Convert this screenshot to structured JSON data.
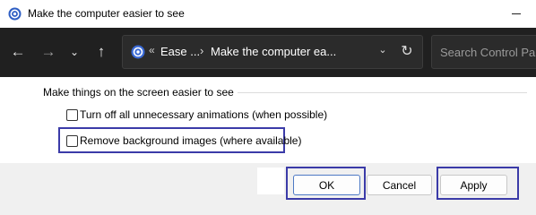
{
  "window": {
    "title": "Make the computer easier to see",
    "icon": "ease-of-access-icon",
    "controls": [
      "minimize-icon"
    ]
  },
  "nav": {
    "back_icon": "←",
    "forward_icon": "→",
    "recent_icon": "⌄",
    "up_icon": "↑",
    "breadcrumb_prefix": "«",
    "breadcrumb": [
      "Ease ...",
      "Make the computer ea..."
    ],
    "separator": "›",
    "dropdown_icon": "⌄",
    "refresh_icon": "↻",
    "search_placeholder": "Search Control Pan"
  },
  "content": {
    "group_label": "Make things on the screen easier to see",
    "options": [
      {
        "label": "Turn off all unnecessary animations (when possible)",
        "checked": false
      },
      {
        "label": "Remove background images (where available)",
        "checked": false,
        "highlighted": true
      }
    ]
  },
  "footer": {
    "buttons": [
      {
        "label": "OK",
        "highlighted": true,
        "default": true
      },
      {
        "label": "Cancel",
        "highlighted": false
      },
      {
        "label": "Apply",
        "highlighted": true
      }
    ]
  },
  "colors": {
    "highlight": "#3b3ba8",
    "navbar_bg": "#202020",
    "address_bg": "#2b2b2b",
    "accent": "#4d79c4"
  }
}
